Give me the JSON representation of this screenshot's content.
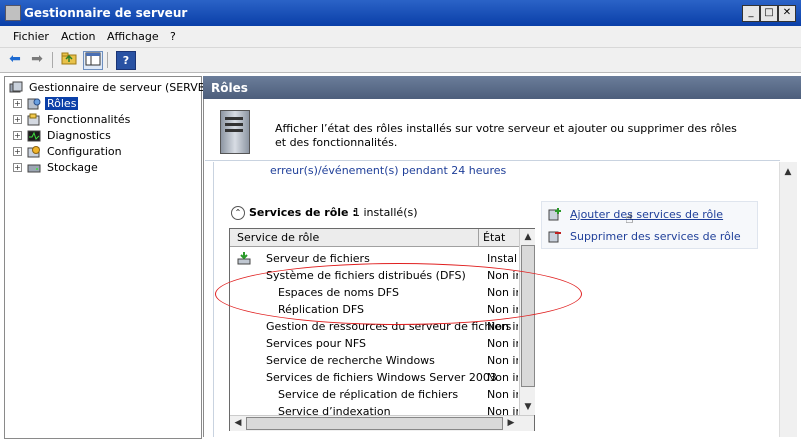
{
  "window": {
    "title": "Gestionnaire de serveur",
    "buttons": {
      "minimize": "_",
      "maximize": "□",
      "close": "✕"
    }
  },
  "menu": {
    "items": [
      "Fichier",
      "Action",
      "Affichage",
      "?"
    ]
  },
  "toolbar": {
    "help": "?"
  },
  "tree": {
    "root": "Gestionnaire de serveur (SERVB)",
    "items": [
      {
        "label": "Rôles",
        "selected": true
      },
      {
        "label": "Fonctionnalités"
      },
      {
        "label": "Diagnostics"
      },
      {
        "label": "Configuration"
      },
      {
        "label": "Stockage"
      }
    ]
  },
  "roles": {
    "header": "Rôles",
    "info": "Afficher l’état des rôles installés sur votre serveur et ajouter ou supprimer des rôles et des fonctionnalités.",
    "events": "erreur(s)/événement(s) pendant 24 heures"
  },
  "role_services": {
    "title": "Services de rôle :",
    "count": "1 installé(s)",
    "columns": [
      "Service de rôle",
      "État"
    ],
    "rows": [
      {
        "name": "Serveur de fichiers",
        "state": "Installé"
      },
      {
        "name": "Système de fichiers distribués (DFS)",
        "state": "Non installé"
      },
      {
        "name": "Espaces de noms DFS",
        "state": "Non installé"
      },
      {
        "name": "Réplication DFS",
        "state": "Non installé"
      },
      {
        "name": "Gestion de ressources du serveur de fichiers",
        "state": "Non installé"
      },
      {
        "name": "Services pour NFS",
        "state": "Non installé"
      },
      {
        "name": "Service de recherche Windows",
        "state": "Non installé"
      },
      {
        "name": "Services de fichiers Windows Server 2003",
        "state": "Non installé"
      },
      {
        "name": "Service de réplication de fichiers",
        "state": "Non installé"
      },
      {
        "name": "Service d’indexation",
        "state": "Non installé"
      }
    ]
  },
  "actions": {
    "add": "Ajouter des services de rôle",
    "remove": "Supprimer des services de rôle"
  },
  "colors": {
    "link": "#1f3f99",
    "highlight": "#e02020",
    "header": "#5a6b88"
  }
}
